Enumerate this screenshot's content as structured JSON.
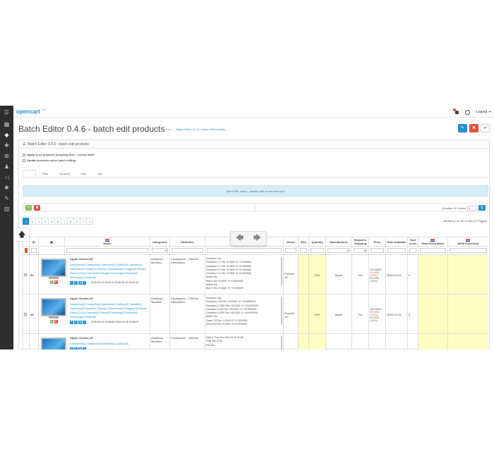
{
  "header": {
    "logo": "opencart",
    "logout": "Logout"
  },
  "page": {
    "title": "Batch Editor 0.4.6 - batch edit products",
    "breadcrumb": [
      "Home",
      "Batch Editor 0.4.6 - batch edit products"
    ]
  },
  "panel": {
    "title": "Batch Editor 0.4.6 - batch edit products",
    "checkbox_apply": "Apply to all products including filter - current Main",
    "checkbox_update": "Update products when batch editing",
    "tabs": [
      "-",
      "Filter",
      "General",
      "Link",
      "Tool"
    ],
    "info": "Call HTML editor - double click on the text field.",
    "quantity_copies_label": "Quantity Of Copies",
    "quantity_copies_value": "1",
    "pages": [
      "1",
      "2",
      "3",
      "4",
      "5",
      "6",
      "7",
      "8",
      "9",
      ">",
      ">|"
    ],
    "showing": "Showing 1 to 30 of 330 (12 Pages)"
  },
  "table": {
    "headers": [
      "ID",
      "",
      "Name",
      "Categories",
      "Attributes",
      "Options",
      "Model",
      "SKU",
      "Quantity",
      "Manufacturer",
      "Requires Shipping",
      "Price",
      "Date Available",
      "Sort Order",
      "Meta Description",
      "Meta Keywords"
    ],
    "rows": [
      {
        "id": "50",
        "name": "Apple Cinema 30\"",
        "links": [
          "Description(2)",
          "Categories(2)",
          "Attributes(2)",
          "Options(3)",
          "Specials(1)",
          "Discounts(0)",
          "Related(4)",
          "Stores(1)",
          "Downloads(0)",
          "Images(0)",
          "Reward Points (CG)(1)",
          "Layouts(0)",
          "Filters(0)",
          "Recurring(0)",
          "Reviews(0)",
          "Returning(0)",
          "Review(0)"
        ],
        "dates": "2016-09-13 21:09:11   2016-09-30 23:09:16",
        "categories": [
          "Desktops",
          "Monitors"
        ],
        "attributes": "Clockspeed - 100mhz Description",
        "options": [
          "Checkbox     Yes",
          "Checkbox 1   0   Yes  +0.0000   +0  +0.0000000",
          "Checkbox 2   0   Yes  +0.0000   +0  +0.0000000",
          "Checkbox 3   0   Yes  +0.0000   +0  +0.0000000",
          "Checkbox 4   0   Yes  +0.0000   +0  +0.0000000",
          "Select       Yes",
          "Red          0   Yes  +0.0000   +0  +0.0000000",
          "Select       Yes",
          "Blue         0   Yes  +0.0000   +0  +0.0000000"
        ],
        "model": "Product 15",
        "quantity": "990",
        "manufacturer": "Apple",
        "shipping": "Yes",
        "price": "120.0000",
        "price_special": "90.0000",
        "price_special_note": "(-25%)",
        "price_disc": "60.0000",
        "price_disc_note": "(-49%)",
        "date": "2009-02-04",
        "sort": "0"
      },
      {
        "id": "49",
        "name": "Apple Cinema 30\"",
        "links": [
          "Description(2)",
          "Categories(2)",
          "Attributes(2)",
          "Options(3)",
          "Specials(1)",
          "Discounts(0)",
          "Related(4)",
          "Stores(1)",
          "Downloads(0)",
          "Images(14)",
          "Reward Points (CG)(1)",
          "Layouts(0)",
          "Filters(0)",
          "Recurring(0)",
          "Reviews(0)",
          "Returning(0)",
          "Review(0)"
        ],
        "dates": "2016-09-12 19:06:50   2016-09-30 20:06:47",
        "categories": [
          "Desktops",
          "Monitors"
        ],
        "attributes": "Clockspeed - 100mhz Description",
        "options": [
          "Checkbox     Yes",
          "Checkbox 1   80   Yes  +10.0000  +0  +10.0000000",
          "Checkbox 2   2000 Yes  +20.0000  +0  +20.0000000",
          "Checkbox 3   190  Yes  +30.0000  +0  +30.0000000",
          "Checkbox 4   2000 Yes  +40.0000  +0  +40.0000000",
          "Select       Yes",
          "Green        720  No   +1.0000   +0  +1.0000000",
          "Red          2000 Yes  +4.0000   +0  +4.0000000"
        ],
        "model": "Product 15",
        "quantity": "990",
        "manufacturer": "Apple",
        "shipping": "Yes",
        "price": "120.0000",
        "price_special": "90.0000",
        "price_special_note": "(-25%)",
        "price_disc": "60.0000",
        "price_disc_note": "(-49%)",
        "date": "2009-02-04",
        "sort": "0"
      },
      {
        "id": "",
        "name": "Apple Cinema 30\"",
        "links": [
          "Description(2)",
          "Categories(2)",
          "Attributes(2)",
          "Options(3)"
        ],
        "dates": "",
        "categories": [
          "Desktops",
          "Monitors"
        ],
        "attributes": "Clockspeed - 100mhz",
        "options": [
          "Date & Time   Yes   2011-02-20 22:25",
          "Time          Yes   22:25",
          "File          Yes"
        ],
        "model": "",
        "quantity": "",
        "manufacturer": "",
        "shipping": "",
        "price": "120.0000",
        "price_special": "",
        "price_special_note": "",
        "price_disc": "",
        "price_disc_note": "",
        "date": "",
        "sort": ""
      }
    ]
  },
  "colors": {
    "accent": "#1e91cf",
    "danger": "#e3503e",
    "success": "#8fbb6c",
    "sidebar": "#2e2e2e",
    "meta_highlight": "#fefec2"
  }
}
